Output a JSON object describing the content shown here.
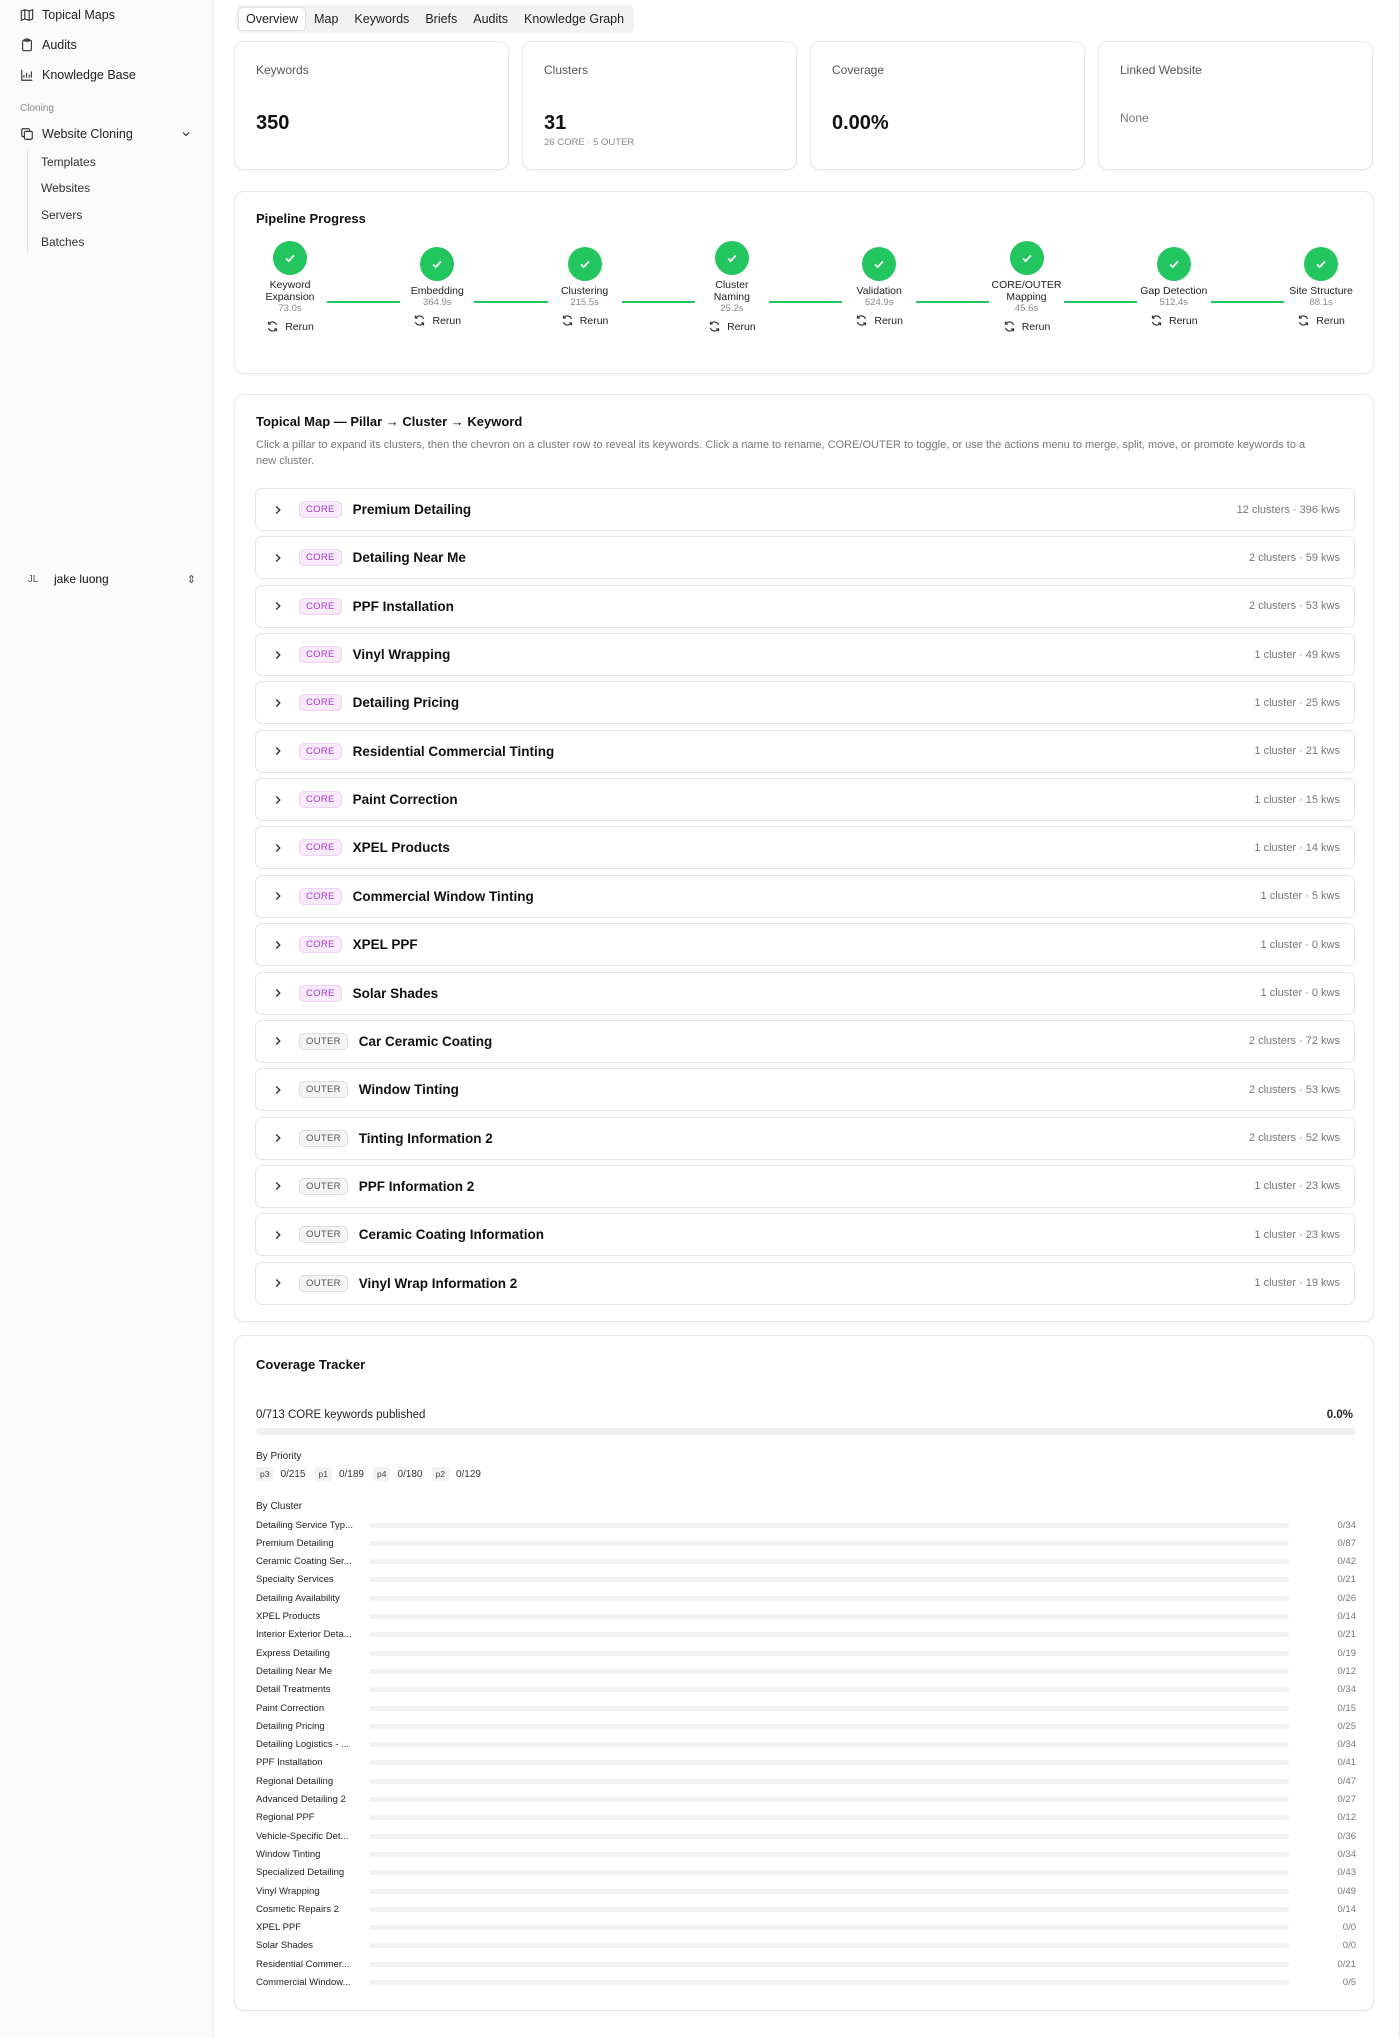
{
  "sidebar": {
    "items": [
      {
        "label": "Topical Maps",
        "icon": "map-icon"
      },
      {
        "label": "Audits",
        "icon": "clipboard-icon"
      },
      {
        "label": "Knowledge Base",
        "icon": "chart-icon"
      }
    ],
    "section": "Cloning",
    "group": {
      "label": "Website Cloning",
      "icon": "copy-icon"
    },
    "subitems": [
      "Templates",
      "Websites",
      "Servers",
      "Batches"
    ],
    "user": {
      "initials": "JL",
      "name": "jake luong"
    }
  },
  "tabs": [
    "Overview",
    "Map",
    "Keywords",
    "Briefs",
    "Audits",
    "Knowledge Graph"
  ],
  "stats": {
    "keywords": {
      "label": "Keywords",
      "value": "350"
    },
    "clusters": {
      "label": "Clusters",
      "value": "31",
      "sub": "26 CORE · 5 OUTER"
    },
    "coverage": {
      "label": "Coverage",
      "value": "0.00%"
    },
    "linked": {
      "label": "Linked Website",
      "value": "None"
    }
  },
  "pipeline": {
    "title": "Pipeline Progress",
    "rerun_label": "Rerun",
    "accent": "#22c55e",
    "steps": [
      {
        "name": "Keyword Expansion",
        "time": "73.0s"
      },
      {
        "name": "Embedding",
        "time": "364.9s"
      },
      {
        "name": "Clustering",
        "time": "215.5s"
      },
      {
        "name": "Cluster Naming",
        "time": "25.2s"
      },
      {
        "name": "Validation",
        "time": "524.9s"
      },
      {
        "name": "CORE/OUTER Mapping",
        "time": "45.6s"
      },
      {
        "name": "Gap Detection",
        "time": "512.4s"
      },
      {
        "name": "Site Structure",
        "time": "88.1s"
      }
    ]
  },
  "topical_map": {
    "title": "Topical Map — Pillar → Cluster → Keyword",
    "description": "Click a pillar to expand its clusters, then the chevron on a cluster row to reveal its keywords. Click a name to rename, CORE/OUTER to toggle, or use the actions menu to merge, split, move, or promote keywords to a new cluster.",
    "pillars": [
      {
        "tag": "CORE",
        "name": "Premium Detailing",
        "meta": "12 clusters · 396 kws"
      },
      {
        "tag": "CORE",
        "name": "Detailing Near Me",
        "meta": "2 clusters · 59 kws"
      },
      {
        "tag": "CORE",
        "name": "PPF Installation",
        "meta": "2 clusters · 53 kws"
      },
      {
        "tag": "CORE",
        "name": "Vinyl Wrapping",
        "meta": "1 cluster · 49 kws"
      },
      {
        "tag": "CORE",
        "name": "Detailing Pricing",
        "meta": "1 cluster · 25 kws"
      },
      {
        "tag": "CORE",
        "name": "Residential Commercial Tinting",
        "meta": "1 cluster · 21 kws"
      },
      {
        "tag": "CORE",
        "name": "Paint Correction",
        "meta": "1 cluster · 15 kws"
      },
      {
        "tag": "CORE",
        "name": "XPEL Products",
        "meta": "1 cluster · 14 kws"
      },
      {
        "tag": "CORE",
        "name": "Commercial Window Tinting",
        "meta": "1 cluster · 5 kws"
      },
      {
        "tag": "CORE",
        "name": "XPEL PPF",
        "meta": "1 cluster · 0 kws"
      },
      {
        "tag": "CORE",
        "name": "Solar Shades",
        "meta": "1 cluster · 0 kws"
      },
      {
        "tag": "OUTER",
        "name": "Car Ceramic Coating",
        "meta": "2 clusters · 72 kws"
      },
      {
        "tag": "OUTER",
        "name": "Window Tinting",
        "meta": "2 clusters · 53 kws"
      },
      {
        "tag": "OUTER",
        "name": "Tinting Information 2",
        "meta": "2 clusters · 52 kws"
      },
      {
        "tag": "OUTER",
        "name": "PPF Information 2",
        "meta": "1 cluster · 23 kws"
      },
      {
        "tag": "OUTER",
        "name": "Ceramic Coating Information",
        "meta": "1 cluster · 23 kws"
      },
      {
        "tag": "OUTER",
        "name": "Vinyl Wrap Information 2",
        "meta": "1 cluster · 19 kws"
      }
    ]
  },
  "coverage": {
    "title": "Coverage Tracker",
    "summary": "0/713 CORE keywords published",
    "percent": "0.0%",
    "progress": 0,
    "by_priority_label": "By Priority",
    "priorities": [
      {
        "key": "p3",
        "value": "0/215"
      },
      {
        "key": "p1",
        "value": "0/189"
      },
      {
        "key": "p4",
        "value": "0/180"
      },
      {
        "key": "p2",
        "value": "0/129"
      }
    ],
    "by_cluster_label": "By Cluster",
    "clusters": [
      {
        "name": "Detailing Service Typ...",
        "value": "0/34"
      },
      {
        "name": "Premium Detailing",
        "value": "0/87"
      },
      {
        "name": "Ceramic Coating Ser...",
        "value": "0/42"
      },
      {
        "name": "Specialty Services",
        "value": "0/21"
      },
      {
        "name": "Detailing Availability",
        "value": "0/26"
      },
      {
        "name": "XPEL Products",
        "value": "0/14"
      },
      {
        "name": "Interior Exterior Deta...",
        "value": "0/21"
      },
      {
        "name": "Express Detailing",
        "value": "0/19"
      },
      {
        "name": "Detailing Near Me",
        "value": "0/12"
      },
      {
        "name": "Detail Treatments",
        "value": "0/34"
      },
      {
        "name": "Paint Correction",
        "value": "0/15"
      },
      {
        "name": "Detailing Pricing",
        "value": "0/25"
      },
      {
        "name": "Detailing Logistics - ...",
        "value": "0/34"
      },
      {
        "name": "PPF Installation",
        "value": "0/41"
      },
      {
        "name": "Regional Detailing",
        "value": "0/47"
      },
      {
        "name": "Advanced Detailing 2",
        "value": "0/27"
      },
      {
        "name": "Regional PPF",
        "value": "0/12"
      },
      {
        "name": "Vehicle-Specific Det...",
        "value": "0/36"
      },
      {
        "name": "Window Tinting",
        "value": "0/34"
      },
      {
        "name": "Specialized Detailing",
        "value": "0/43"
      },
      {
        "name": "Vinyl Wrapping",
        "value": "0/49"
      },
      {
        "name": "Cosmetic Repairs 2",
        "value": "0/14"
      },
      {
        "name": "XPEL PPF",
        "value": "0/0"
      },
      {
        "name": "Solar Shades",
        "value": "0/0"
      },
      {
        "name": "Residential Commer...",
        "value": "0/21"
      },
      {
        "name": "Commercial Window...",
        "value": "0/5"
      }
    ]
  }
}
